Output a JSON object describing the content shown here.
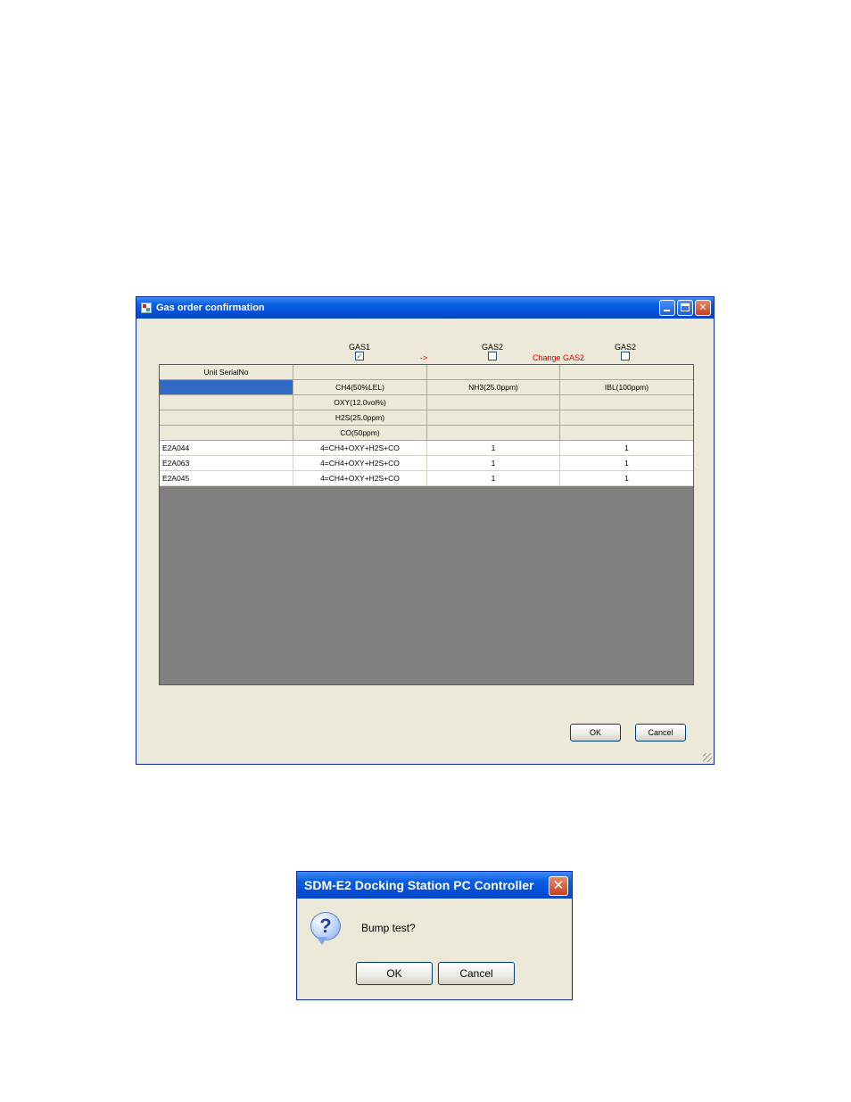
{
  "gas_window": {
    "title": "Gas order confirmation",
    "gas_headers": [
      {
        "label": "GAS1",
        "checked": true
      },
      {
        "label": "GAS2",
        "checked": false
      },
      {
        "label": "GAS2",
        "checked": false
      }
    ],
    "arrow_text": "->",
    "change_text": "Change GAS2",
    "grid": {
      "header_rows": [
        [
          "Unit SerialNo",
          "",
          "",
          ""
        ],
        [
          "",
          "CH4(50%LEL)",
          "NH3(25.0ppm)",
          "IBL(100ppm)"
        ],
        [
          "",
          "OXY(12.0vol%)",
          "",
          ""
        ],
        [
          "",
          "H2S(25.0ppm)",
          "",
          ""
        ],
        [
          "",
          "CO(50ppm)",
          "",
          ""
        ]
      ],
      "data_rows": [
        [
          "E2A044",
          "4=CH4+OXY+H2S+CO",
          "1",
          "1"
        ],
        [
          "E2A063",
          "4=CH4+OXY+H2S+CO",
          "1",
          "1"
        ],
        [
          "E2A045",
          "4=CH4+OXY+H2S+CO",
          "1",
          "1"
        ]
      ]
    },
    "ok_label": "OK",
    "cancel_label": "Cancel"
  },
  "message_box": {
    "title": "SDM-E2 Docking Station PC Controller",
    "message": "Bump test?",
    "icon": "question-icon",
    "ok_label": "OK",
    "cancel_label": "Cancel"
  },
  "colors": {
    "title_bar": "#0a5fe0",
    "dialog_bg": "#ece9d8",
    "grid_empty": "#808080",
    "selection": "#316ac5",
    "change_text": "#e00000"
  }
}
